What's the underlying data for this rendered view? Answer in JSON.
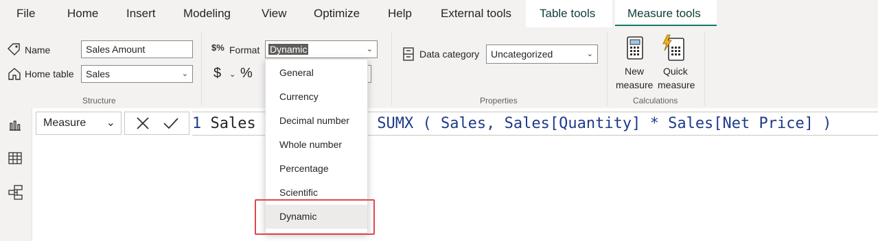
{
  "menu": {
    "items": [
      "File",
      "Home",
      "Insert",
      "Modeling",
      "View",
      "Optimize",
      "Help",
      "External tools"
    ],
    "context_tabs": [
      "Table tools",
      "Measure tools"
    ],
    "active_tab": "Measure tools"
  },
  "structure": {
    "name_label": "Name",
    "name_value": "Sales Amount",
    "home_table_label": "Home table",
    "home_table_value": "Sales",
    "group_label": "Structure"
  },
  "formatting": {
    "format_label": "Format",
    "format_value": "Dynamic",
    "currency_symbol": "$",
    "percent_symbol": "%",
    "options": [
      "General",
      "Currency",
      "Decimal number",
      "Whole number",
      "Percentage",
      "Scientific",
      "Dynamic"
    ],
    "selected_option": "Dynamic"
  },
  "properties": {
    "data_category_label": "Data category",
    "data_category_value": "Uncategorized",
    "group_label": "Properties"
  },
  "calculations": {
    "new_measure_line1": "New",
    "new_measure_line2": "measure",
    "quick_measure_line1": "Quick",
    "quick_measure_line2": "measure",
    "group_label": "Calculations"
  },
  "formula": {
    "selector_value": "Measure",
    "line_number": "1",
    "text_before": "Sales",
    "text_after": "SUMX ( Sales, Sales[Quantity] * Sales[Net Price] )"
  },
  "colors": {
    "accent": "#117865",
    "highlight_border": "#e0454f",
    "dax_function": "#1e3a8a"
  }
}
